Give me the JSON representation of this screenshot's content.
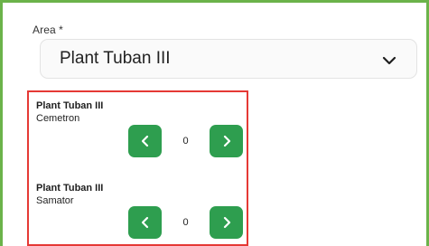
{
  "area": {
    "label": "Area *",
    "selected": "Plant Tuban III",
    "icon": "chevron-down-icon"
  },
  "items": [
    {
      "title": "Plant Tuban III",
      "subtitle": "Cemetron",
      "value": "0"
    },
    {
      "title": "Plant Tuban III",
      "subtitle": "Samator",
      "value": "0"
    }
  ],
  "colors": {
    "accent_green": "#2e9e4f",
    "frame_border": "#6bb34a",
    "highlight_border": "#e53935"
  }
}
